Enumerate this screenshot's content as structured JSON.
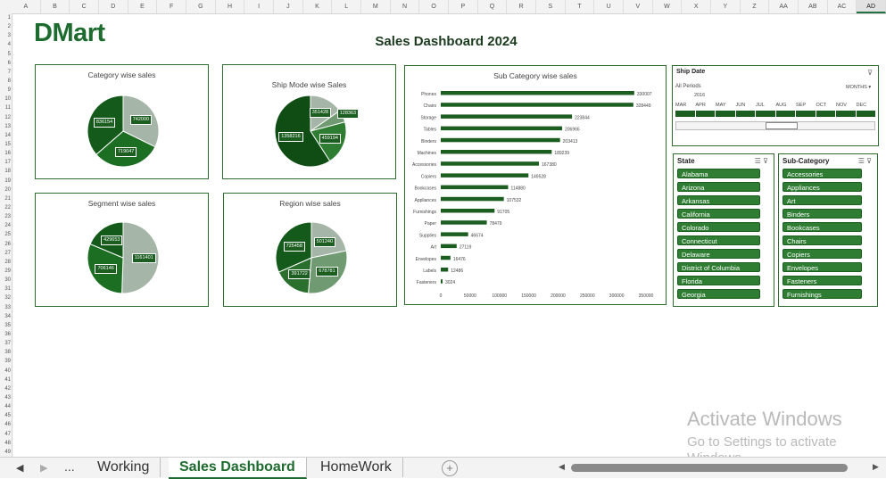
{
  "logo": {
    "text": "DMart"
  },
  "title": "Sales Dashboard 2024",
  "colors": {
    "dark": "#1b5e20",
    "mid": "#2e7d32",
    "light": "#a5b5a7",
    "grey": "#6f9a72"
  },
  "column_headers": [
    "A",
    "B",
    "C",
    "D",
    "E",
    "F",
    "G",
    "H",
    "I",
    "J",
    "K",
    "L",
    "M",
    "N",
    "O",
    "P",
    "Q",
    "R",
    "S",
    "T",
    "U",
    "V",
    "W",
    "X",
    "Y",
    "Z",
    "AA",
    "AB",
    "AC",
    "AD"
  ],
  "row_headers": [
    "1",
    "2",
    "3",
    "4",
    "5",
    "6",
    "7",
    "8",
    "9",
    "10",
    "11",
    "12",
    "13",
    "14",
    "15",
    "16",
    "17",
    "18",
    "19",
    "20",
    "21",
    "22",
    "23",
    "24",
    "25",
    "26",
    "27",
    "28",
    "29",
    "30",
    "31",
    "32",
    "33",
    "34",
    "35",
    "36",
    "37",
    "38",
    "39",
    "40",
    "41",
    "42",
    "43",
    "44",
    "45",
    "46",
    "47",
    "48",
    "49"
  ],
  "panels": {
    "category": {
      "title": "Category wise sales"
    },
    "shipmode": {
      "title": "Ship Mode wise Sales"
    },
    "segment": {
      "title": "Segment wise sales"
    },
    "region": {
      "title": "Region wise sales"
    },
    "subcategory": {
      "title": "Sub Category wise sales"
    }
  },
  "chart_data": [
    {
      "type": "pie",
      "title": "Category wise sales",
      "values": [
        742000,
        719047,
        836154
      ],
      "labels": [
        "742000",
        "719047",
        "836154"
      ]
    },
    {
      "type": "pie",
      "title": "Ship Mode wise Sales",
      "values": [
        351428,
        128363,
        459194,
        1358216
      ],
      "labels": [
        "351428",
        "128363",
        "459194",
        "1358216"
      ]
    },
    {
      "type": "pie",
      "title": "Segment wise sales",
      "values": [
        1161401,
        706146,
        429653
      ],
      "labels": [
        "1161401",
        "706146",
        "429653"
      ]
    },
    {
      "type": "pie",
      "title": "Region wise sales",
      "values": [
        501240,
        678781,
        391722,
        725458
      ],
      "labels": [
        "501240",
        "678781",
        "391722",
        "725458"
      ]
    },
    {
      "type": "bar",
      "orientation": "horizontal",
      "title": "Sub Category wise sales",
      "categories": [
        "Phones",
        "Chairs",
        "Storage",
        "Tables",
        "Binders",
        "Machines",
        "Accessories",
        "Copiers",
        "Bookcases",
        "Appliances",
        "Furnishings",
        "Paper",
        "Supplies",
        "Art",
        "Envelopes",
        "Labels",
        "Fasteners"
      ],
      "values": [
        330007,
        328449,
        223844,
        206966,
        203413,
        189239,
        167380,
        149528,
        114880,
        107532,
        91705,
        78479,
        46674,
        27119,
        16476,
        12486,
        3024
      ],
      "xticks": [
        "0",
        "50000",
        "100000",
        "150000",
        "200000",
        "250000",
        "300000",
        "350000"
      ],
      "xlim": [
        0,
        350000
      ]
    }
  ],
  "shipdate": {
    "title": "Ship Date",
    "all_periods": "All Periods",
    "unit": "MONTHS",
    "year": "2016",
    "months": [
      "MAR",
      "APR",
      "MAY",
      "JUN",
      "JUL",
      "AUG",
      "SEP",
      "OCT",
      "NOV",
      "DEC"
    ]
  },
  "state": {
    "title": "State",
    "items": [
      "Alabama",
      "Arizona",
      "Arkansas",
      "California",
      "Colorado",
      "Connecticut",
      "Delaware",
      "District of Columbia",
      "Florida",
      "Georgia"
    ]
  },
  "subcat_slicer": {
    "title": "Sub-Category",
    "items": [
      "Accessories",
      "Appliances",
      "Art",
      "Binders",
      "Bookcases",
      "Chairs",
      "Copiers",
      "Envelopes",
      "Fasteners",
      "Furnishings"
    ]
  },
  "tabs": [
    "Working",
    "Sales Dashboard",
    "HomeWork"
  ],
  "nav": {
    "ellipsis": "..."
  },
  "watermark": {
    "line1": "Activate Windows",
    "line2": "Go to Settings to activate",
    "line3": "Windows."
  }
}
